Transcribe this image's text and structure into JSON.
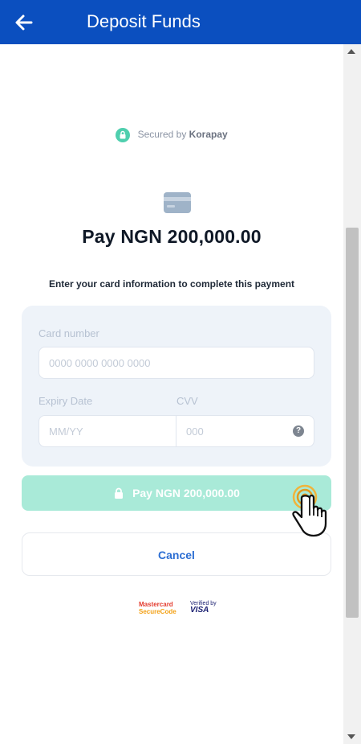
{
  "header": {
    "title": "Deposit Funds",
    "back_icon": "arrow-left-icon",
    "background": "#0b4fbf"
  },
  "payment": {
    "secured_prefix": "Secured by",
    "secured_brand": "Korapay",
    "title": "Pay NGN 200,000.00",
    "instruction": "Enter your card information to complete this payment"
  },
  "form": {
    "card_number_label": "Card number",
    "card_number_placeholder": "0000 0000 0000 0000",
    "expiry_label": "Expiry Date",
    "expiry_placeholder": "MM/YY",
    "cvv_label": "CVV",
    "cvv_placeholder": "000",
    "cvv_help": "?"
  },
  "buttons": {
    "pay_label": "Pay NGN 200,000.00",
    "cancel_label": "Cancel"
  },
  "badges": {
    "mastercard_line1": "Mastercard",
    "mastercard_line2": "SecureCode",
    "visa_line1": "Verified by",
    "visa_line2": "VISA"
  },
  "colors": {
    "accent_green": "#4fcfae",
    "pay_button": "#a9ead8",
    "cancel_text": "#2c6ed3"
  }
}
